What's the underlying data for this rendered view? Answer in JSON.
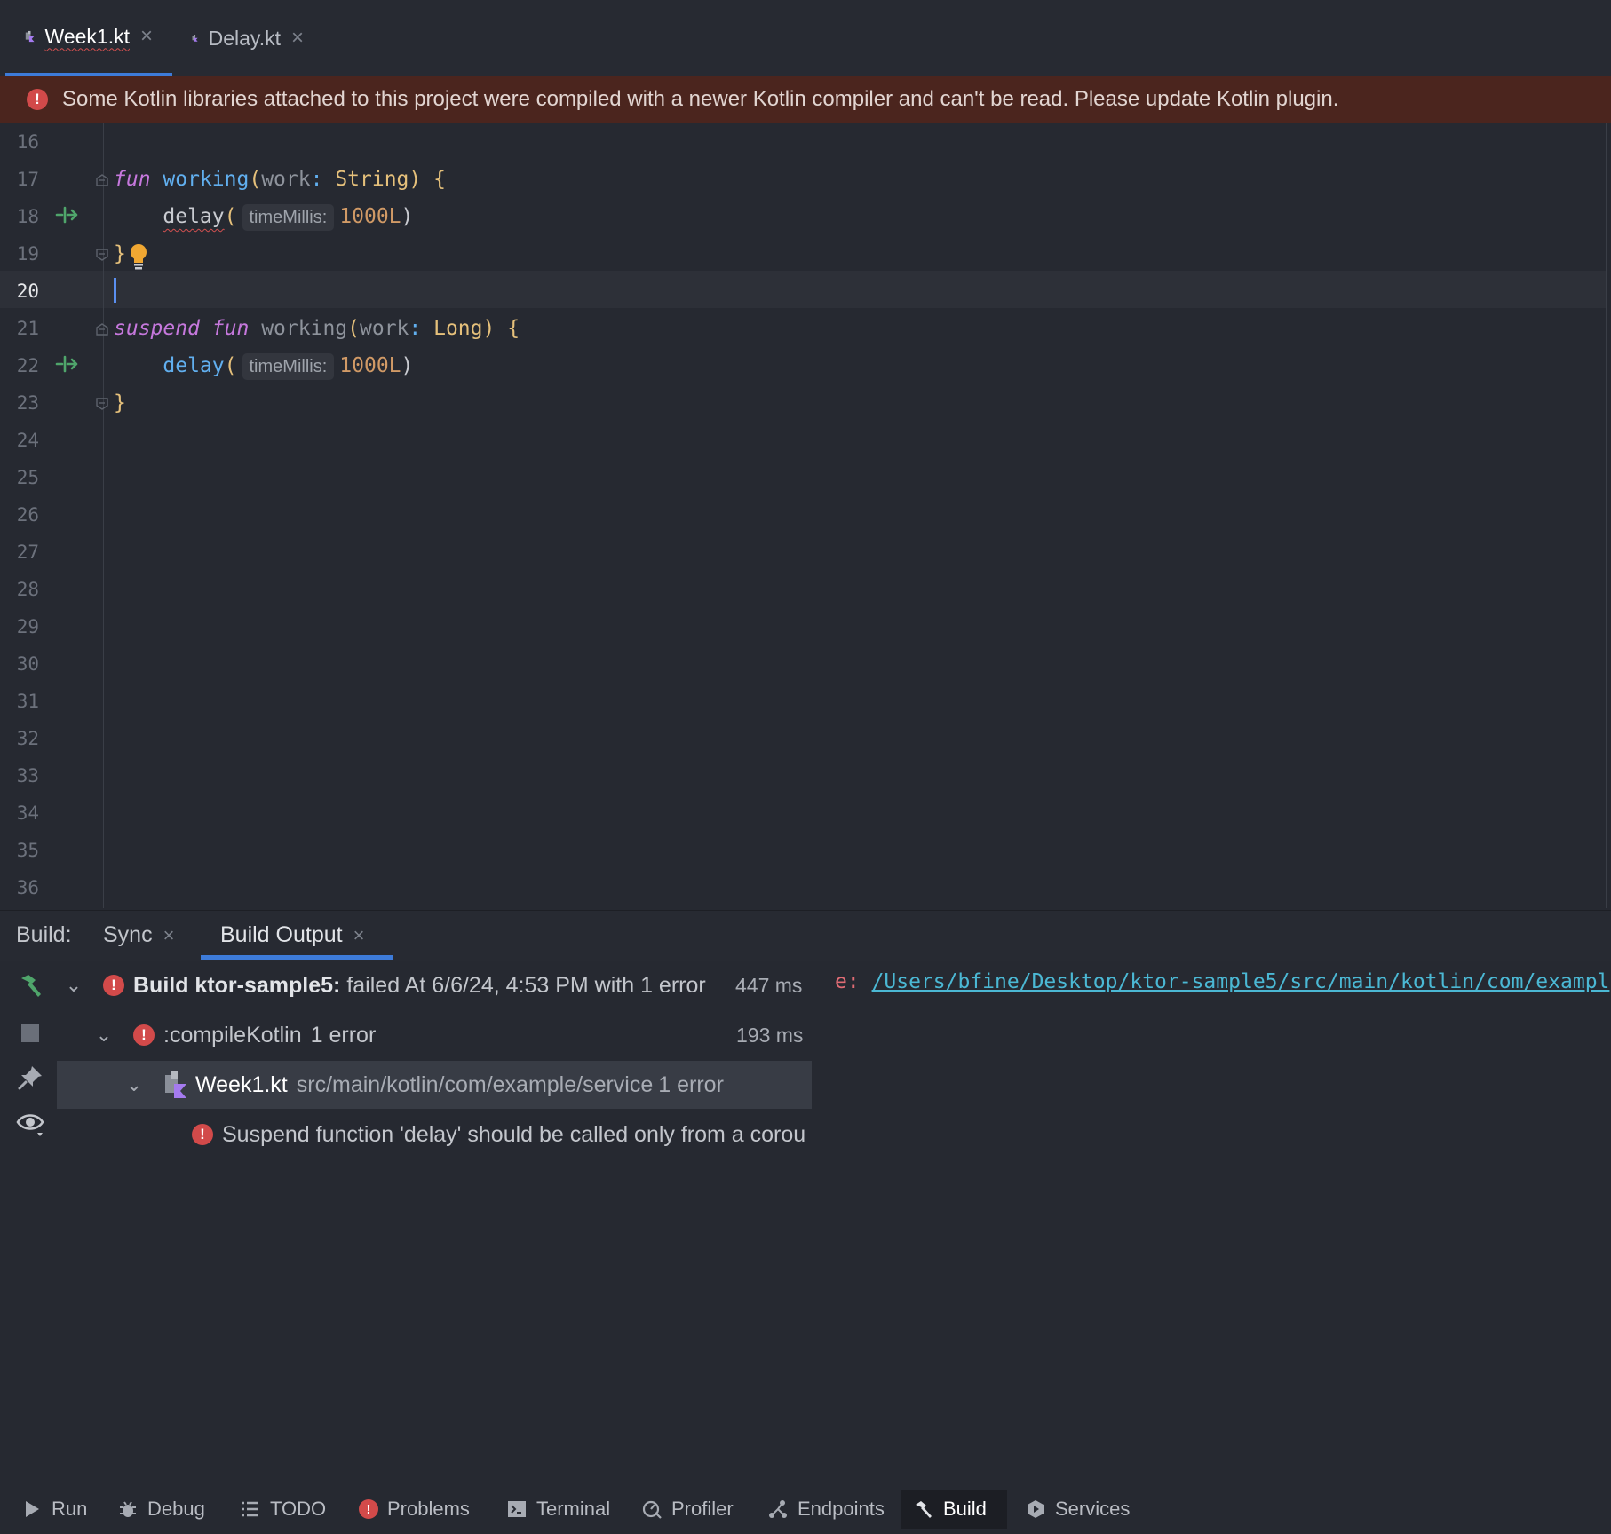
{
  "editor_tabs": [
    {
      "label": "Week1.kt",
      "icon": "kotlin-file-icon",
      "active": true
    },
    {
      "label": "Delay.kt",
      "icon": "kotlin-file-icon",
      "active": false
    }
  ],
  "banner": {
    "icon": "error-icon",
    "text": "Some Kotlin libraries attached to this project were compiled with a newer Kotlin compiler and can't be read. Please update Kotlin plugin."
  },
  "editor": {
    "line_numbers": [
      "16",
      "17",
      "18",
      "19",
      "20",
      "21",
      "22",
      "23",
      "24",
      "25",
      "26",
      "27",
      "28",
      "29",
      "30",
      "31",
      "32",
      "33",
      "34",
      "35",
      "36"
    ],
    "current_line": "20",
    "code": {
      "l17": {
        "kw": "fun",
        "fn": "working",
        "open": "(",
        "param": "work",
        "colon": ":",
        "type": "String",
        "close": ")",
        "brace": "{"
      },
      "l18": {
        "call": "delay",
        "open": "(",
        "hint": "timeMillis:",
        "value": "1000L",
        "close": ")"
      },
      "l19": {
        "brace": "}"
      },
      "l21": {
        "kw1": "suspend",
        "kw2": "fun",
        "fn": "working",
        "open": "(",
        "param": "work",
        "colon": ":",
        "type": "Long",
        "close": ")",
        "brace": "{"
      },
      "l22": {
        "call": "delay",
        "open": "(",
        "hint": "timeMillis:",
        "value": "1000L",
        "close": ")"
      },
      "l23": {
        "brace": "}"
      }
    }
  },
  "build": {
    "label": "Build:",
    "tabs": [
      {
        "label": "Sync",
        "active": false
      },
      {
        "label": "Build Output",
        "active": true
      }
    ],
    "tree": {
      "root": {
        "bold": "Build ktor-sample5:",
        "text": "failed At 6/6/24, 4:53 PM with 1 error",
        "time": "447 ms"
      },
      "task": {
        "label": ":compileKotlin",
        "count": "1 error",
        "time": "193 ms"
      },
      "file": {
        "label": "Week1.kt",
        "path": "src/main/kotlin/com/example/service",
        "count": "1 error"
      },
      "message": {
        "text": "Suspend function 'delay' should be called only from a corou"
      }
    },
    "console": {
      "prefix": "e:",
      "link": "/Users/bfine/Desktop/ktor-sample5/src/main/kotlin/com/exampl"
    }
  },
  "tool_windows": [
    {
      "label": "Run",
      "icon": "run-icon"
    },
    {
      "label": "Debug",
      "icon": "debug-icon"
    },
    {
      "label": "TODO",
      "icon": "todo-icon"
    },
    {
      "label": "Problems",
      "icon": "problems-icon"
    },
    {
      "label": "Terminal",
      "icon": "terminal-icon"
    },
    {
      "label": "Profiler",
      "icon": "profiler-icon"
    },
    {
      "label": "Endpoints",
      "icon": "endpoints-icon"
    },
    {
      "label": "Build",
      "icon": "hammer-icon",
      "active": true
    },
    {
      "label": "Services",
      "icon": "services-icon"
    }
  ],
  "colors": {
    "background": "#262931",
    "accent": "#3d7bd9",
    "error": "#d24a4a",
    "banner_bg": "#4b251e",
    "keyword": "#c678dd",
    "function": "#61afef",
    "type": "#e5c07b",
    "number": "#d19a66",
    "link": "#4bb8d4"
  }
}
